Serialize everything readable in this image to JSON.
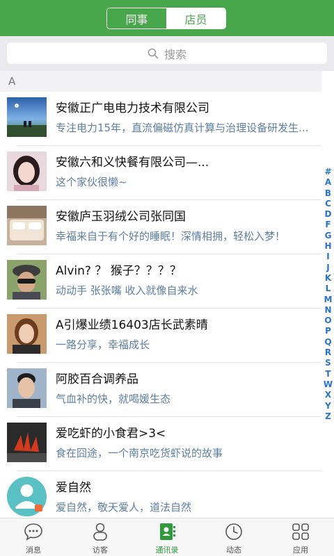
{
  "header": {
    "tabs": [
      {
        "label": "同事",
        "active": true
      },
      {
        "label": "店员",
        "active": false
      }
    ],
    "accent_color": "#47a74a"
  },
  "search": {
    "placeholder": "搜索",
    "icon": "search-icon"
  },
  "section": {
    "letter": "A"
  },
  "contacts": [
    {
      "name": "安徽正广电电力技术有限公司",
      "signature": "专注电力15年，直流偏磁仿真计算与治理设备研发生..."
    },
    {
      "name": "安徽六和义快餐有限公司—...",
      "signature": "这个家伙很懒~"
    },
    {
      "name": "安徽庐玉羽绒公司张同国",
      "signature": "幸福来自于有个好的睡眠！深情相拥，轻松入梦！"
    },
    {
      "name": "Alvin? ？ 猴子？？？？",
      "signature": "动动手 张张嘴 收入就像自来水"
    },
    {
      "name": "A引爆业绩16403店长武素晴",
      "signature": "一路分享，幸福成长"
    },
    {
      "name": "阿胶百合调养品",
      "signature": "气血补的快，就喝媛生态"
    },
    {
      "name": "爱吃虾的小食君>3<",
      "signature": "食在囧途，一个南京吃货虾说的故事"
    },
    {
      "name": "爱自然",
      "signature": "爱自然，敬天爱人，道法自然"
    }
  ],
  "alphabet_index": [
    "#",
    "A",
    "B",
    "C",
    "D",
    "F",
    "G",
    "H",
    "I",
    "J",
    "K",
    "L",
    "M",
    "N",
    "O",
    "P",
    "Q",
    "R",
    "S",
    "T",
    "W",
    "X",
    "Y",
    "Z"
  ],
  "tabbar": [
    {
      "label": "消息",
      "icon": "message-icon",
      "active": false
    },
    {
      "label": "访客",
      "icon": "visitor-icon",
      "active": false
    },
    {
      "label": "通讯录",
      "icon": "contacts-icon",
      "active": true
    },
    {
      "label": "动态",
      "icon": "clock-icon",
      "active": false
    },
    {
      "label": "应用",
      "icon": "apps-grid-icon",
      "active": false
    }
  ]
}
